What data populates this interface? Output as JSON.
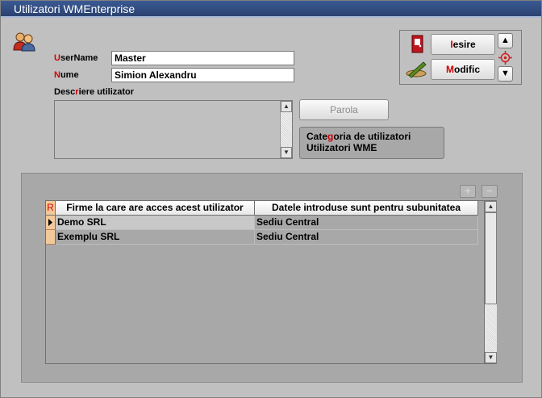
{
  "window": {
    "title": "Utilizatori WMEnterprise"
  },
  "form": {
    "username_label_hot": "U",
    "username_label_rest": "serName",
    "username_value": "Master",
    "name_label_hot": "N",
    "name_label_rest": "ume",
    "name_value": "Simion Alexandru",
    "desc_label_pre": "Desc",
    "desc_label_hot": "r",
    "desc_label_post": "iere utilizator",
    "desc_value": ""
  },
  "buttons": {
    "parola": "Parola",
    "iesire_hot": "I",
    "iesire_rest": "esire",
    "modific_hot": "M",
    "modific_rest": "odific"
  },
  "category": {
    "line1_pre": "Cate",
    "line1_hot": "g",
    "line1_post": "oria de utilizatori",
    "line2": "Utilizatori WME"
  },
  "grid": {
    "indicator_header": "R",
    "columns": [
      "Firme la care are acces acest utilizator",
      "Datele introduse sunt pentru subunitatea"
    ],
    "rows": [
      {
        "firma": "Demo SRL",
        "subunitate": "Sediu Central"
      },
      {
        "firma": "Exemplu SRL",
        "subunitate": "Sediu Central"
      }
    ]
  },
  "colors": {
    "title_bar": "#2f4a7e",
    "hotkey": "#d00000",
    "indicator": "#f3c99a"
  }
}
